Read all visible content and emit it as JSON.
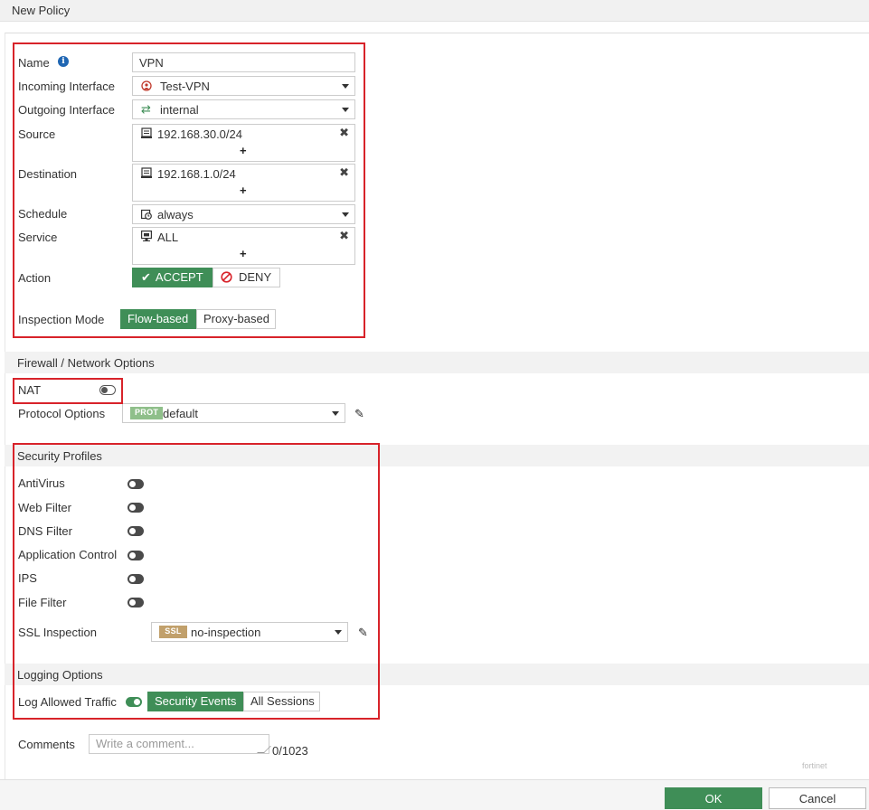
{
  "window": {
    "title": "New Policy"
  },
  "form": {
    "name": {
      "label": "Name",
      "value": "VPN"
    },
    "incoming": {
      "label": "Incoming Interface",
      "value": "Test-VPN"
    },
    "outgoing": {
      "label": "Outgoing Interface",
      "value": "internal"
    },
    "source": {
      "label": "Source",
      "value": "192.168.30.0/24"
    },
    "destination": {
      "label": "Destination",
      "value": "192.168.1.0/24"
    },
    "schedule": {
      "label": "Schedule",
      "value": "always"
    },
    "service": {
      "label": "Service",
      "value": "ALL"
    },
    "action": {
      "label": "Action",
      "accept": "ACCEPT",
      "deny": "DENY",
      "selected": "ACCEPT"
    },
    "inspection": {
      "label": "Inspection Mode",
      "flow": "Flow-based",
      "proxy": "Proxy-based",
      "selected": "Flow-based"
    }
  },
  "firewall": {
    "header": "Firewall / Network Options",
    "nat": {
      "label": "NAT",
      "enabled": false
    },
    "protocol": {
      "label": "Protocol Options",
      "tag": "PROT",
      "value": "default"
    }
  },
  "security": {
    "header": "Security Profiles",
    "items": [
      {
        "label": "AntiVirus",
        "enabled": false
      },
      {
        "label": "Web Filter",
        "enabled": false
      },
      {
        "label": "DNS Filter",
        "enabled": false
      },
      {
        "label": "Application Control",
        "enabled": false
      },
      {
        "label": "IPS",
        "enabled": false
      },
      {
        "label": "File Filter",
        "enabled": false
      }
    ],
    "ssl": {
      "label": "SSL Inspection",
      "tag": "SSL",
      "value": "no-inspection"
    }
  },
  "logging": {
    "header": "Logging Options",
    "label": "Log Allowed Traffic",
    "enabled": true,
    "security_events": "Security Events",
    "all_sessions": "All Sessions",
    "selected": "Security Events"
  },
  "comments": {
    "label": "Comments",
    "placeholder": "Write a comment...",
    "counter": "0/1023"
  },
  "watermark": "fortinet",
  "footer": {
    "ok": "OK",
    "cancel": "Cancel"
  },
  "colors": {
    "accent": "#3f8e57",
    "highlight": "#d8232a",
    "prot_tag": "#8fbf8a",
    "ssl_tag": "#c1a06b"
  }
}
